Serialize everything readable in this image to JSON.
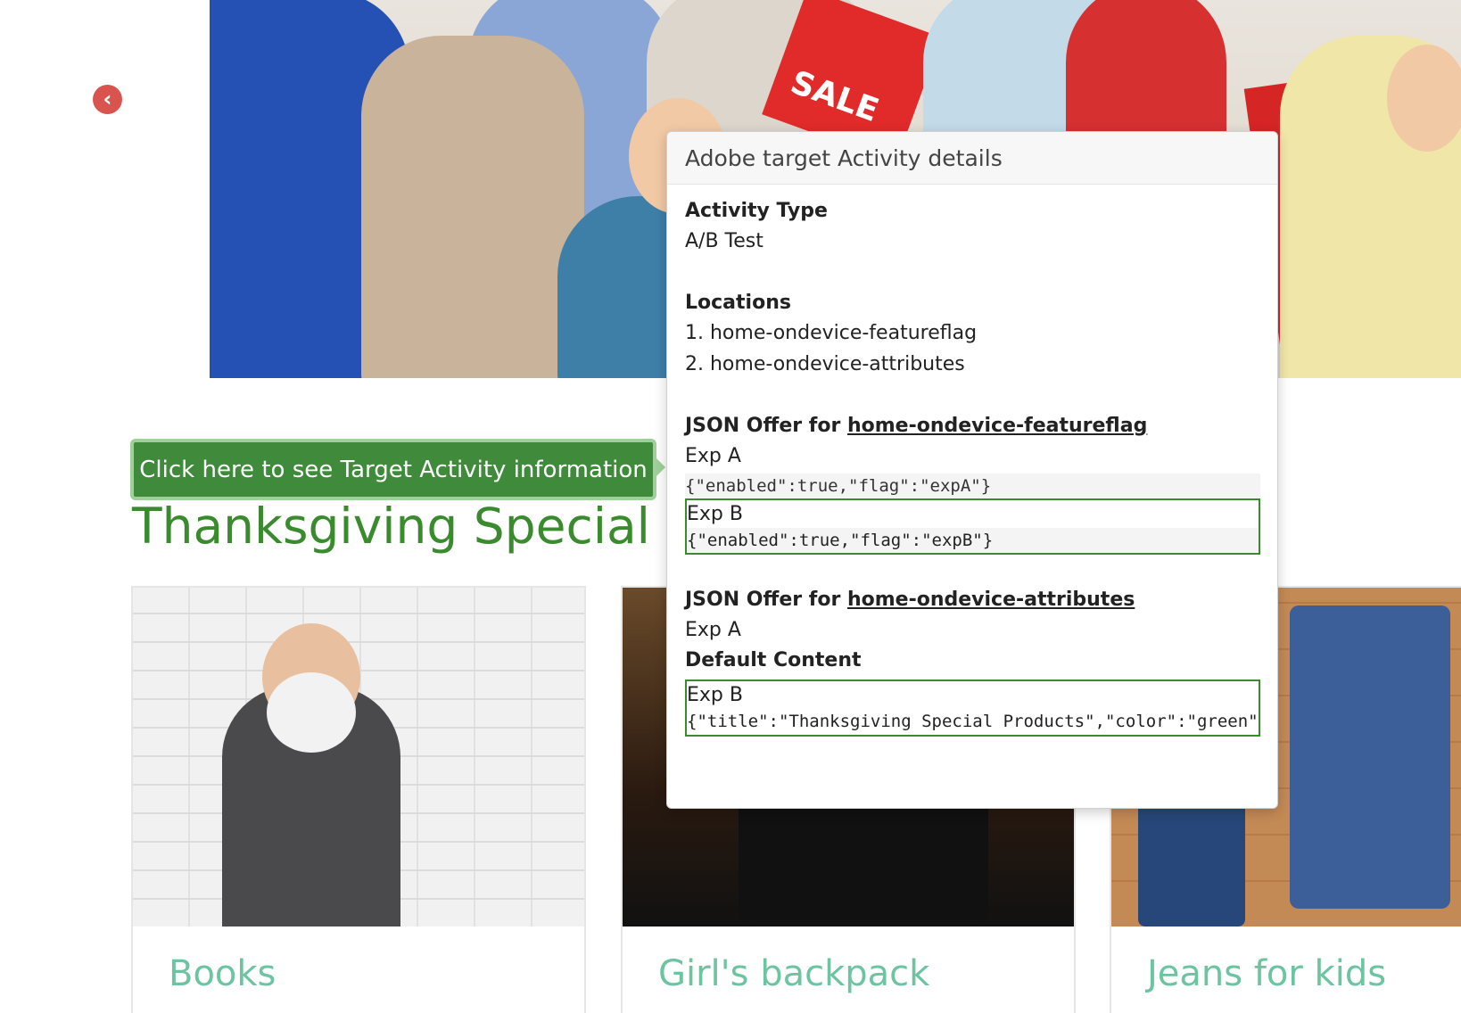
{
  "hero": {
    "bag_text": "SALE"
  },
  "cta": {
    "label": "Click here to see Target Activity information"
  },
  "page_title": "Thanksgiving Special Products",
  "popover": {
    "title": "Adobe target Activity details",
    "activity_type_label": "Activity Type",
    "activity_type_value": "A/B Test",
    "locations_label": "Locations",
    "locations": [
      "1. home-ondevice-featureflag",
      "2. home-ondevice-attributes"
    ],
    "offers": [
      {
        "heading_prefix": "JSON Offer for ",
        "location": "home-ondevice-featureflag",
        "exp_a_label": "Exp A",
        "exp_a_code": "{\"enabled\":true,\"flag\":\"expA\"}",
        "exp_b_label": "Exp B",
        "exp_b_code": "{\"enabled\":true,\"flag\":\"expB\"}"
      },
      {
        "heading_prefix": "JSON Offer for ",
        "location": "home-ondevice-attributes",
        "exp_a_label": "Exp A",
        "exp_a_default": "Default Content",
        "exp_b_label": "Exp B",
        "exp_b_code": "{\"title\":\"Thanksgiving Special Products\",\"color\":\"green\"}"
      }
    ]
  },
  "products": [
    {
      "title": "Books"
    },
    {
      "title": "Girl's backpack"
    },
    {
      "title": "Jeans for kids"
    }
  ],
  "colors": {
    "accent_green": "#3a8a2e",
    "cta_bg": "#3f8b3b",
    "arrow_red": "#d9534f",
    "card_title": "#6cc4a1"
  }
}
